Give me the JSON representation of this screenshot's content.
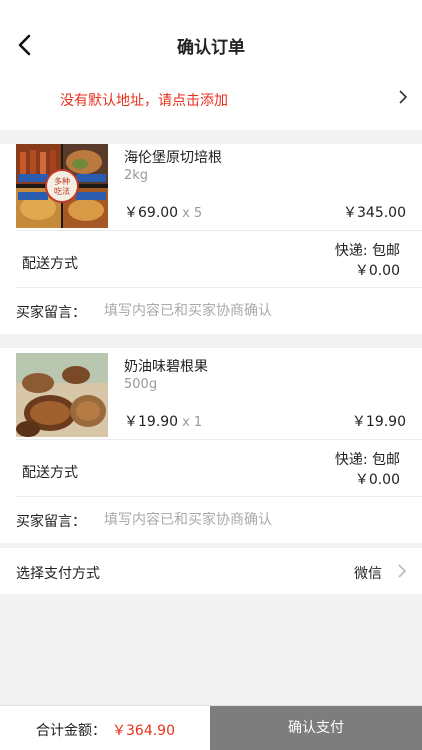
{
  "header": {
    "title": "确认订单"
  },
  "address": {
    "prompt": "没有默认地址，请点击添加"
  },
  "items": [
    {
      "name": "海伦堡原切培根",
      "spec": "2kg",
      "price": "￥69.00",
      "qty": "x 5",
      "subtotal": "￥345.00",
      "image_badges": [
        "多种",
        "吃法"
      ],
      "shipping_label": "配送方式",
      "shipping_method": "快递: 包邮",
      "shipping_fee": "￥0.00",
      "message_label": "买家留言：",
      "message_placeholder": "填写内容已和买家协商确认"
    },
    {
      "name": "奶油味碧根果",
      "spec": "500g",
      "price": "￥19.90",
      "qty": "x 1",
      "subtotal": "￥19.90",
      "shipping_label": "配送方式",
      "shipping_method": "快递: 包邮",
      "shipping_fee": "￥0.00",
      "message_label": "买家留言：",
      "message_placeholder": "填写内容已和买家协商确认"
    }
  ],
  "payment": {
    "label": "选择支付方式",
    "value": "微信"
  },
  "footer": {
    "total_label": "合计金额：",
    "total_value": "￥364.90",
    "submit_label": "确认支付"
  },
  "colors": {
    "accent": "#e8301c",
    "submit_bg": "#7d7d7d",
    "page_bg": "#f2f2f2"
  }
}
